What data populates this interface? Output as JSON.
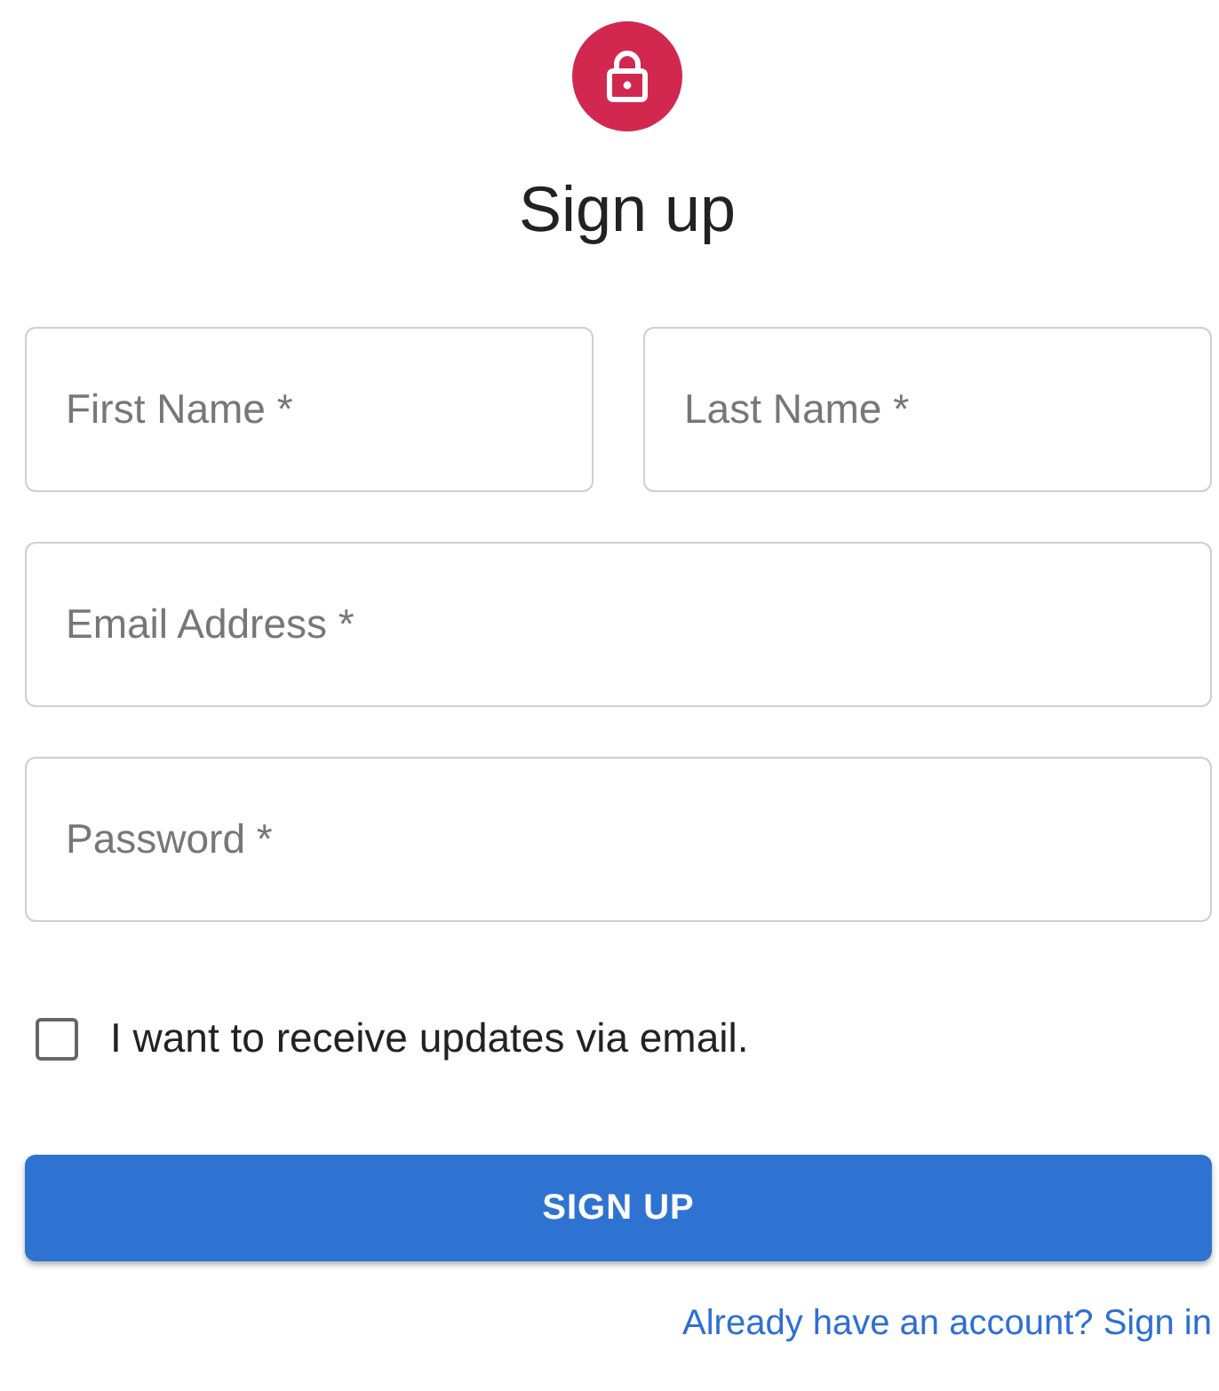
{
  "title": "Sign up",
  "name_fields": [
    {
      "placeholder": "First Name *"
    },
    {
      "placeholder": "Last Name *"
    }
  ],
  "fields": [
    {
      "placeholder": "Email Address *"
    },
    {
      "placeholder": "Password *"
    }
  ],
  "consent": {
    "label": "I want to receive updates via email.",
    "checked": false
  },
  "submit": "SIGN UP",
  "link": "Already have an account? Sign in"
}
